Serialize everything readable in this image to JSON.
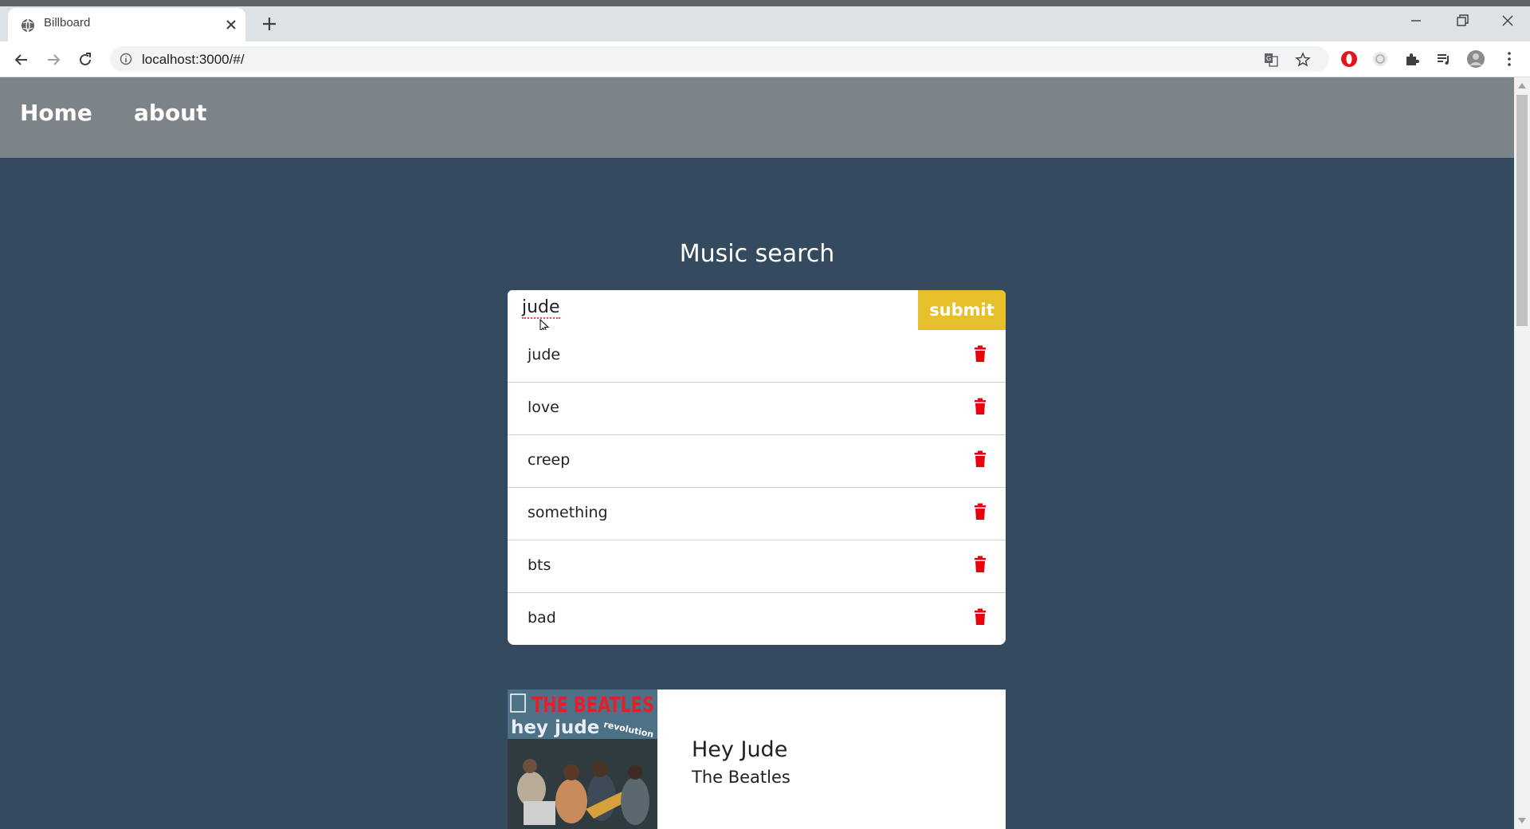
{
  "browser": {
    "tab_title": "Billboard",
    "url": "localhost:3000/#/"
  },
  "nav": {
    "home": "Home",
    "about": "about"
  },
  "page": {
    "title": "Music search",
    "search_value": "jude",
    "submit_label": "submit"
  },
  "history": [
    {
      "term": "jude"
    },
    {
      "term": "love"
    },
    {
      "term": "creep"
    },
    {
      "term": "something"
    },
    {
      "term": "bts"
    },
    {
      "term": "bad"
    }
  ],
  "result": {
    "title": "Hey Jude",
    "artist": "The Beatles",
    "cover": {
      "band": "THE BEATLES",
      "album": "hey jude",
      "b_side": "revolution"
    }
  },
  "colors": {
    "page_bg": "#344b5f",
    "nav_bg": "#7c8389",
    "submit_bg": "#e6c02a",
    "trash": "#e8000d"
  }
}
